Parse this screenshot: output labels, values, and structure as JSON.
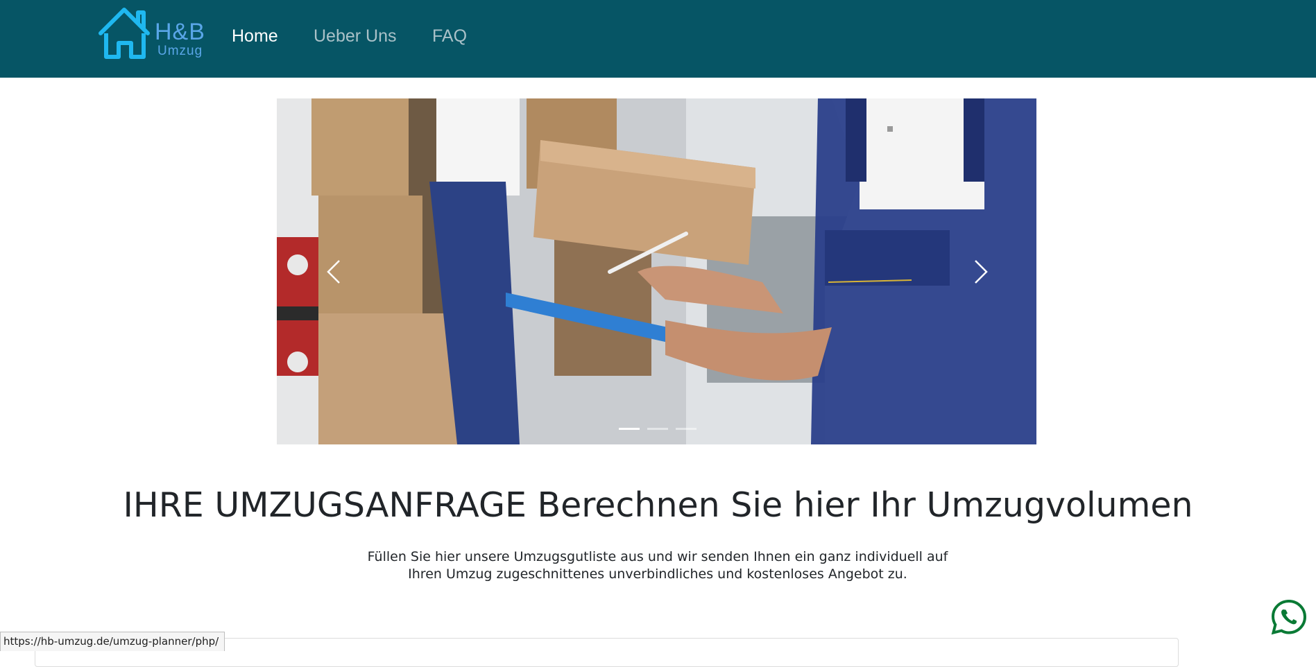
{
  "brand": {
    "name": "H&B",
    "subtitle": "Umzug"
  },
  "nav": {
    "items": [
      "Home",
      "Ueber Uns",
      "FAQ"
    ],
    "active": "Home"
  },
  "carousel": {
    "slide_count": 3,
    "active_index": 0
  },
  "hero": {
    "title": "IHRE UMZUGSANFRAGE Berechnen Sie hier Ihr Umzugvolumen",
    "text": "Füllen Sie hier unsere Umzugsgutliste aus und wir senden Ihnen ein ganz individuell auf Ihren Umzug zugeschnittenes unverbindliches und kostenloses Angebot zu."
  },
  "status_bar": {
    "url": "https://hb-umzug.de/umzug-planner/php/"
  },
  "colors": {
    "navbar": "#065565",
    "logo": "#1fb8f0",
    "whatsapp": "#128c7e"
  },
  "icons": {
    "logo": "house-icon",
    "prev": "chevron-left-icon",
    "next": "chevron-right-icon",
    "whatsapp": "whatsapp-icon"
  }
}
